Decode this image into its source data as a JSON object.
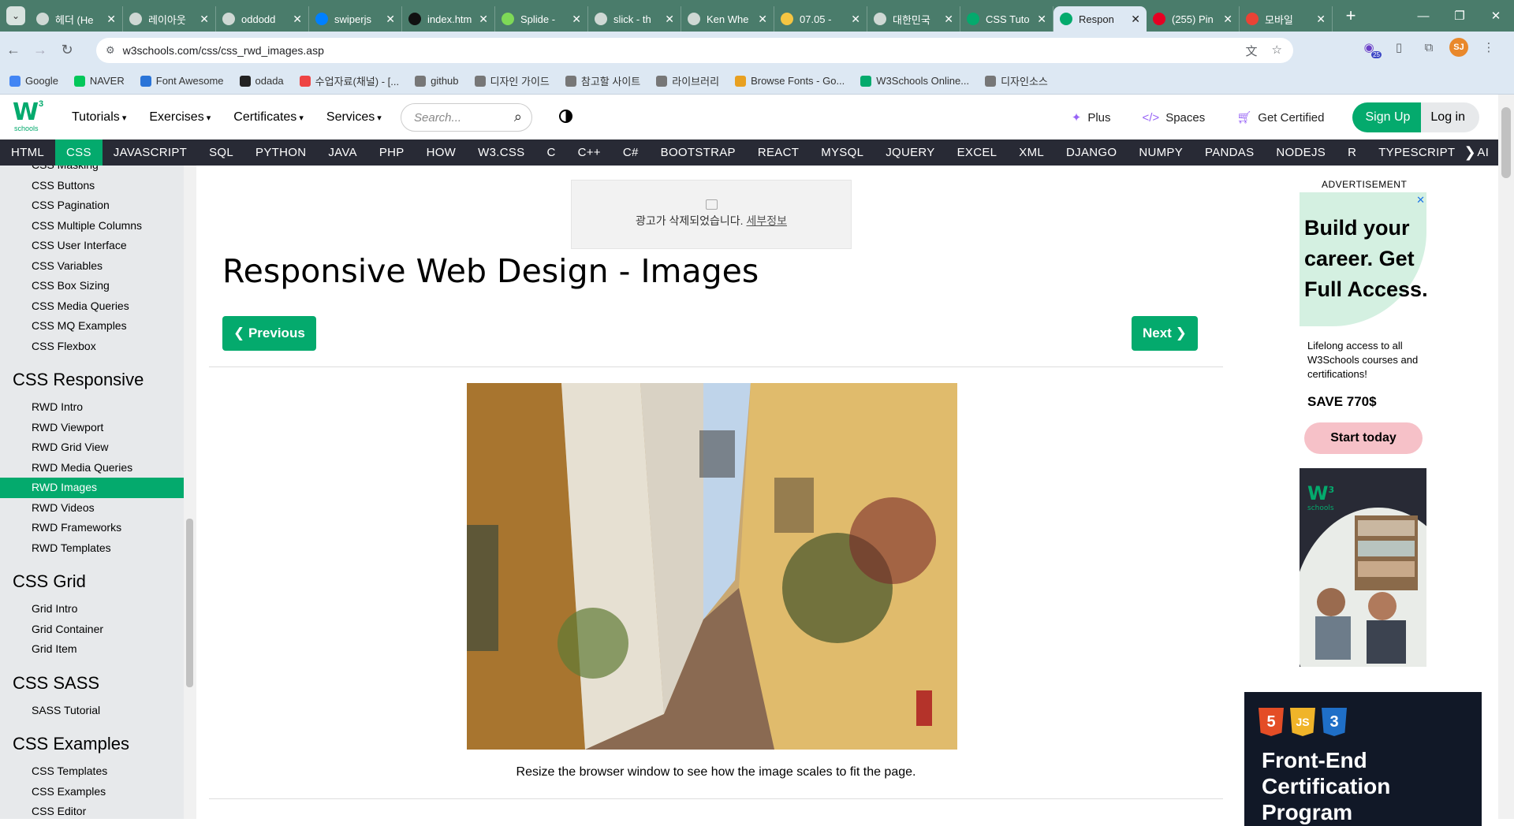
{
  "browser": {
    "tabs": [
      {
        "label": "헤더 (He",
        "icon": "github-icon"
      },
      {
        "label": "레이아웃",
        "icon": "chrome-icon"
      },
      {
        "label": "oddodd",
        "icon": "github-icon"
      },
      {
        "label": "swiperjs",
        "icon": "swiper-icon"
      },
      {
        "label": "index.htm",
        "icon": "codepen-icon"
      },
      {
        "label": "Splide - ",
        "icon": "splide-icon"
      },
      {
        "label": "slick - th",
        "icon": "github-icon"
      },
      {
        "label": "Ken Whe",
        "icon": "github-icon"
      },
      {
        "label": "07.05 - ",
        "icon": "pencil-icon"
      },
      {
        "label": "대한민국",
        "icon": "github-icon"
      },
      {
        "label": "CSS Tuto",
        "icon": "w3schools-icon"
      },
      {
        "label": "Respon",
        "icon": "w3schools-icon",
        "active": true
      },
      {
        "label": "(255) Pin",
        "icon": "pinterest-icon"
      },
      {
        "label": "모바일 ",
        "icon": "gmail-icon"
      }
    ],
    "url": "w3schools.com/css/css_rwd_images.asp",
    "avatar_initials": "SJ",
    "extension_badge": "25",
    "bookmarks": [
      "Google",
      "NAVER",
      "Font Awesome",
      "odada",
      "수업자료(채널) - [...",
      "github",
      "디자인 가이드",
      "참고할 사이트",
      "라이브러리",
      "Browse Fonts - Go...",
      "W3Schools Online...",
      "디자인소스"
    ]
  },
  "header": {
    "logo_text": "W",
    "logo_sup": "3",
    "logo_sub": "schools",
    "menu": [
      "Tutorials",
      "Exercises",
      "Certificates",
      "Services"
    ],
    "search_placeholder": "Search...",
    "right": {
      "plus": "Plus",
      "spaces": "Spaces",
      "certified": "Get Certified",
      "signup": "Sign Up",
      "login": "Log in"
    }
  },
  "topnav": [
    "HTML",
    "CSS",
    "JAVASCRIPT",
    "SQL",
    "PYTHON",
    "JAVA",
    "PHP",
    "HOW TO",
    "W3.CSS",
    "C",
    "C++",
    "C#",
    "BOOTSTRAP",
    "REACT",
    "MYSQL",
    "JQUERY",
    "EXCEL",
    "XML",
    "DJANGO",
    "NUMPY",
    "PANDAS",
    "NODEJS",
    "R",
    "TYPESCRIPT",
    "AI"
  ],
  "sidebar": {
    "groups": [
      {
        "heading": "",
        "items": [
          "CSS Masking",
          "CSS Buttons",
          "CSS Pagination",
          "CSS Multiple Columns",
          "CSS User Interface",
          "CSS Variables",
          "CSS Box Sizing",
          "CSS Media Queries",
          "CSS MQ Examples",
          "CSS Flexbox"
        ]
      },
      {
        "heading": "CSS Responsive",
        "items": [
          "RWD Intro",
          "RWD Viewport",
          "RWD Grid View",
          "RWD Media Queries",
          "RWD Images",
          "RWD Videos",
          "RWD Frameworks",
          "RWD Templates"
        ]
      },
      {
        "heading": "CSS Grid",
        "items": [
          "Grid Intro",
          "Grid Container",
          "Grid Item"
        ]
      },
      {
        "heading": "CSS SASS",
        "items": [
          "SASS Tutorial"
        ]
      },
      {
        "heading": "CSS Examples",
        "items": [
          "CSS Templates",
          "CSS Examples",
          "CSS Editor"
        ]
      }
    ],
    "active": "RWD Images"
  },
  "main": {
    "ad_removed": "광고가 삭제되었습니다.",
    "ad_details": "세부정보",
    "title": "Responsive Web Design - Images",
    "prev": "❮ Previous",
    "next": "Next ❯",
    "caption": "Resize the browser window to see how the image scales to fit the page."
  },
  "ads": {
    "label": "ADVERTISEMENT",
    "headline": "Build your career. Get Full Access.",
    "body": "Lifelong access to all W3Schools courses and certifications!",
    "save": "SAVE 770$",
    "cta": "Start today",
    "logo_sup": "3",
    "logo_sub": "schools",
    "ad2_badges": [
      "5",
      "JS",
      "3"
    ],
    "ad2_title": "Front-End Certification Program"
  },
  "colors": {
    "brand": "#04aa6d",
    "nav_dark": "#282a35",
    "chrome": "#4a7c6b"
  }
}
